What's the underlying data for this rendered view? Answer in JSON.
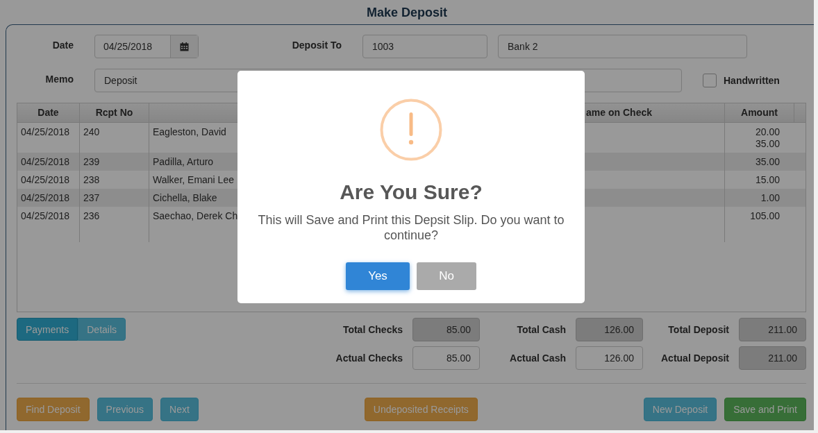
{
  "title": "Make Deposit",
  "form": {
    "date": {
      "label": "Date",
      "value": "04/25/2018"
    },
    "deposit_to": {
      "label": "Deposit To",
      "account": "1003",
      "name": "Bank 2"
    },
    "memo": {
      "label": "Memo",
      "value": "Deposit"
    },
    "handwritten": {
      "label": "Handwritten",
      "checked": false
    }
  },
  "table": {
    "columns": {
      "date": "Date",
      "rcpt_no": "Rcpt No",
      "column_4": "ame on Check",
      "amount": "Amount"
    },
    "rows": [
      {
        "date": "04/25/2018",
        "rcpt_no": "240",
        "name": "Eagleston, David",
        "amounts": [
          "20.00",
          "35.00"
        ]
      },
      {
        "date": "04/25/2018",
        "rcpt_no": "239",
        "name": "Padilla, Arturo",
        "amounts": [
          "35.00"
        ]
      },
      {
        "date": "04/25/2018",
        "rcpt_no": "238",
        "name": "Walker, Emani Lee",
        "amounts": [
          "15.00"
        ]
      },
      {
        "date": "04/25/2018",
        "rcpt_no": "237",
        "name": "Cichella, Blake",
        "amounts": [
          "1.00"
        ]
      },
      {
        "date": "04/25/2018",
        "rcpt_no": "236",
        "name": "Saechao, Derek Ch",
        "amounts": [
          "105.00"
        ]
      }
    ]
  },
  "view_tabs": [
    {
      "label": "Payments",
      "selected": true
    },
    {
      "label": "Details",
      "selected": false
    }
  ],
  "totals": [
    {
      "label": "Total Checks",
      "value": "85.00",
      "readonly": true
    },
    {
      "label": "Total Cash",
      "value": "126.00",
      "readonly": true
    },
    {
      "label": "Total Deposit",
      "value": "211.00",
      "readonly": true
    },
    {
      "label": "Actual Checks",
      "value": "85.00",
      "readonly": false
    },
    {
      "label": "Actual Cash",
      "value": "126.00",
      "readonly": false
    },
    {
      "label": "Actual Deposit",
      "value": "211.00",
      "readonly": true
    }
  ],
  "buttons_left": [
    {
      "label": "Find Deposit",
      "kind": "warning"
    },
    {
      "label": "Previous",
      "kind": "info"
    },
    {
      "label": "Next",
      "kind": "info"
    }
  ],
  "buttons_center": [
    {
      "label": "Undeposited Receipts",
      "kind": "warning"
    }
  ],
  "buttons_right": [
    {
      "label": "New Deposit",
      "kind": "info"
    },
    {
      "label": "Save and Print",
      "kind": "success"
    }
  ],
  "dialog": {
    "title": "Are You Sure?",
    "message": "This will Save and Print this Depsit Slip. Do you want to continue?",
    "buttons": [
      {
        "label": "Yes",
        "kind": "confirm"
      },
      {
        "label": "No",
        "kind": "cancel"
      }
    ]
  }
}
